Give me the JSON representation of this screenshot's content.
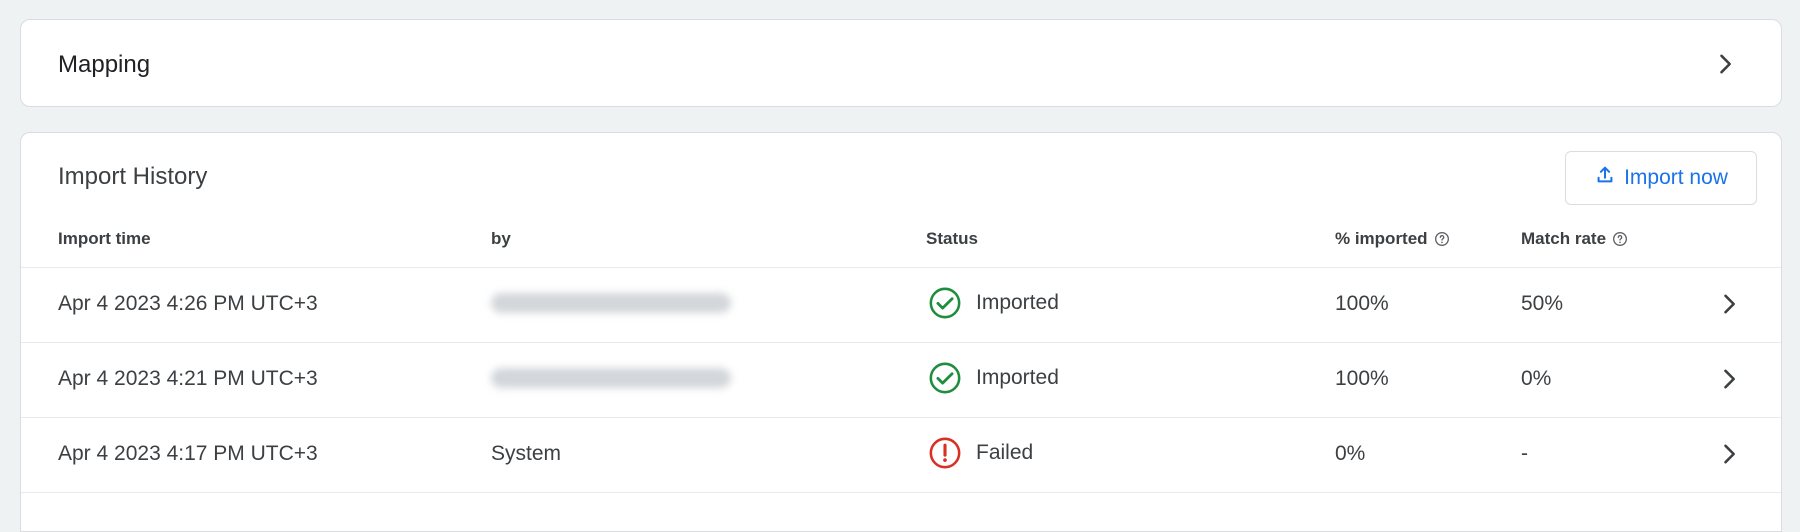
{
  "mapping": {
    "title": "Mapping"
  },
  "history": {
    "title": "Import History",
    "import_button": "Import now",
    "columns": {
      "import_time": "Import time",
      "by": "by",
      "status": "Status",
      "percent_imported": "% imported",
      "match_rate": "Match rate"
    },
    "rows": [
      {
        "time": "Apr 4 2023 4:26 PM UTC+3",
        "by": "",
        "by_redacted": true,
        "status": "Imported",
        "percent": "100%",
        "match": "50%"
      },
      {
        "time": "Apr 4 2023 4:21 PM UTC+3",
        "by": "",
        "by_redacted": true,
        "status": "Imported",
        "percent": "100%",
        "match": "0%"
      },
      {
        "time": "Apr 4 2023 4:17 PM UTC+3",
        "by": "System",
        "by_redacted": false,
        "status": "Failed",
        "percent": "0%",
        "match": "-"
      }
    ]
  },
  "colors": {
    "success": "#1e8e3e",
    "error": "#d93025",
    "accent": "#1a73e8",
    "background": "#eef2f3"
  },
  "icons": {
    "chevron": "chevron-right-icon",
    "upload": "upload-icon",
    "help": "help-circle-icon",
    "success": "check-circle-icon",
    "error": "error-circle-icon"
  }
}
